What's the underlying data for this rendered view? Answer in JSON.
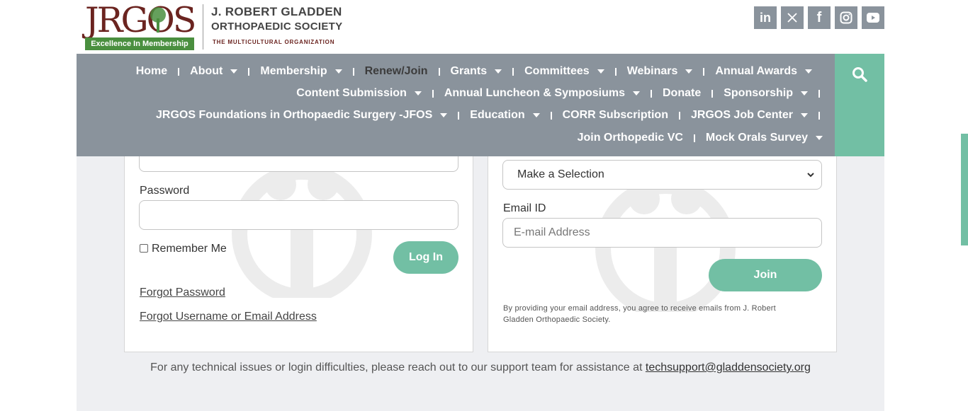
{
  "brand": {
    "logo_letters": "JRGOS",
    "logo_tagline": "Excellence In Membership",
    "name_line1": "J. ROBERT GLADDEN",
    "name_line2": "ORTHOPAEDIC SOCIETY",
    "subtitle": "THE MULTICULTURAL ORGANIZATION",
    "color_primary": "#6b2420",
    "color_accent": "#4a8f3f"
  },
  "social": [
    {
      "icon": "linkedin-icon",
      "label": "in"
    },
    {
      "icon": "x-icon",
      "label": "𝕏"
    },
    {
      "icon": "facebook-icon",
      "label": "f"
    },
    {
      "icon": "instagram-icon",
      "label": ""
    },
    {
      "icon": "youtube-icon",
      "label": ""
    }
  ],
  "nav": {
    "row1": [
      "Home",
      "About",
      "Membership",
      "Renew/Join",
      "Grants",
      "Committees",
      "Webinars",
      "Annual Awards"
    ],
    "row2": [
      "Content Submission",
      "Annual Luncheon & Symposiums",
      "Donate",
      "Sponsorship"
    ],
    "row3": [
      "JRGOS Foundations in Orthopaedic Surgery -JFOS",
      "Education",
      "CORR Subscription",
      "JRGOS Job Center"
    ],
    "row4": [
      "Join Orthopedic VC",
      "Mock Orals Survey"
    ],
    "active": "Renew/Join",
    "bg_color": "#8a939c",
    "accent_color": "#72bfa4"
  },
  "login": {
    "password_label": "Password",
    "remember_label": "Remember Me",
    "login_button": "Log In",
    "forgot_password": "Forgot Password",
    "forgot_username": "Forgot Username or Email Address"
  },
  "join": {
    "select_value": "Make a Selection",
    "email_label": "Email ID",
    "email_placeholder": "E-mail Address",
    "join_button": "Join",
    "disclaimer_line1": "By providing your email address, you agree to receive emails from J. Robert",
    "disclaimer_line2": "Gladden Orthopaedic Society."
  },
  "footer": {
    "support_text": "For any technical issues or login difficulties, please reach out to our support team for assistance at ",
    "support_email": "techsupport@gladdensociety.org"
  }
}
